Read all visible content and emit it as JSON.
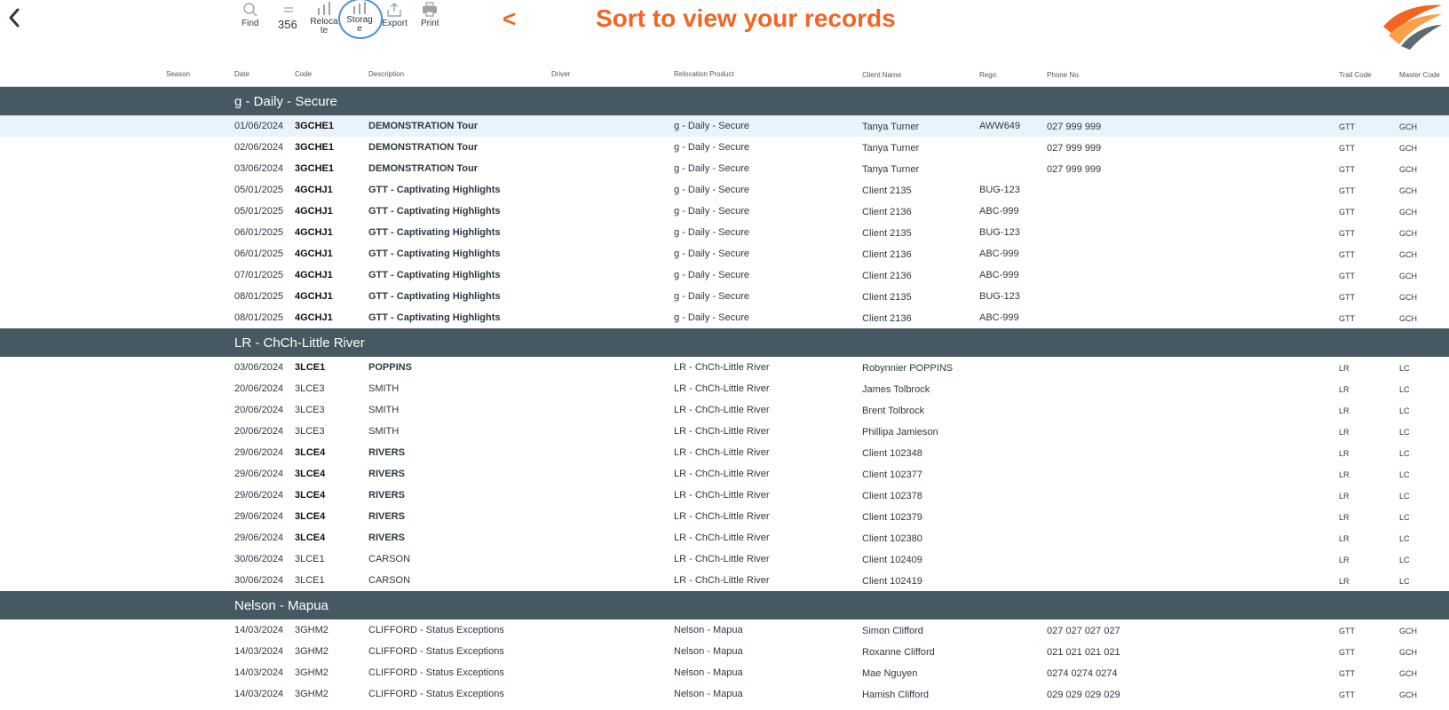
{
  "toolbar": {
    "find_label": "Find",
    "count": "356",
    "relocate_label": "Relocate",
    "storage_label": "Storage",
    "export_label": "Export",
    "print_label": "Print",
    "arrow_text": "<",
    "title": "Sort to view your records"
  },
  "columns": {
    "season": "Season",
    "date": "Date",
    "code": "Code",
    "description": "Description",
    "driver": "Driver",
    "product": "Relocation Product",
    "client": "Client Name",
    "rego": "Rego",
    "phone": "Phone No.",
    "trail": "Trail Code",
    "master": "Master Code"
  },
  "colors": {
    "accent": "#f26522",
    "group_header_bg": "#465861",
    "selected_row_bg": "#eaf2fb",
    "storage_ring": "#4a90d9"
  },
  "groups": [
    {
      "title": "g - Daily - Secure",
      "rows": [
        {
          "date": "01/06/2024",
          "code": "3GCHE1",
          "desc": "DEMONSTRATION Tour",
          "product": "g - Daily - Secure",
          "client": "Tanya Turner",
          "rego": "AWW649",
          "phone": "027 999 999",
          "trail": "GTT",
          "master": "GCH",
          "bold": true,
          "selected": true
        },
        {
          "date": "02/06/2024",
          "code": "3GCHE1",
          "desc": "DEMONSTRATION Tour",
          "product": "g - Daily - Secure",
          "client": "Tanya Turner",
          "rego": "",
          "phone": "027 999 999",
          "trail": "GTT",
          "master": "GCH",
          "bold": true
        },
        {
          "date": "03/06/2024",
          "code": "3GCHE1",
          "desc": "DEMONSTRATION Tour",
          "product": "g - Daily - Secure",
          "client": "Tanya Turner",
          "rego": "",
          "phone": "027 999 999",
          "trail": "GTT",
          "master": "GCH",
          "bold": true
        },
        {
          "date": "05/01/2025",
          "code": "4GCHJ1",
          "desc": "GTT - Captivating Highlights",
          "product": "g - Daily - Secure",
          "client": "Client 2135",
          "rego": "BUG-123",
          "phone": "",
          "trail": "GTT",
          "master": "GCH",
          "bold": true
        },
        {
          "date": "05/01/2025",
          "code": "4GCHJ1",
          "desc": "GTT - Captivating Highlights",
          "product": "g - Daily - Secure",
          "client": "Client 2136",
          "rego": "ABC-999",
          "phone": "",
          "trail": "GTT",
          "master": "GCH",
          "bold": true
        },
        {
          "date": "06/01/2025",
          "code": "4GCHJ1",
          "desc": "GTT - Captivating Highlights",
          "product": "g - Daily - Secure",
          "client": "Client 2135",
          "rego": "BUG-123",
          "phone": "",
          "trail": "GTT",
          "master": "GCH",
          "bold": true
        },
        {
          "date": "06/01/2025",
          "code": "4GCHJ1",
          "desc": "GTT - Captivating Highlights",
          "product": "g - Daily - Secure",
          "client": "Client 2136",
          "rego": "ABC-999",
          "phone": "",
          "trail": "GTT",
          "master": "GCH",
          "bold": true
        },
        {
          "date": "07/01/2025",
          "code": "4GCHJ1",
          "desc": "GTT - Captivating Highlights",
          "product": "g - Daily - Secure",
          "client": "Client 2136",
          "rego": "ABC-999",
          "phone": "",
          "trail": "GTT",
          "master": "GCH",
          "bold": true
        },
        {
          "date": "08/01/2025",
          "code": "4GCHJ1",
          "desc": "GTT - Captivating Highlights",
          "product": "g - Daily - Secure",
          "client": "Client 2135",
          "rego": "BUG-123",
          "phone": "",
          "trail": "GTT",
          "master": "GCH",
          "bold": true
        },
        {
          "date": "08/01/2025",
          "code": "4GCHJ1",
          "desc": "GTT - Captivating Highlights",
          "product": "g - Daily - Secure",
          "client": "Client 2136",
          "rego": "ABC-999",
          "phone": "",
          "trail": "GTT",
          "master": "GCH",
          "bold": true
        }
      ]
    },
    {
      "title": "LR - ChCh-Little River",
      "rows": [
        {
          "date": "03/06/2024",
          "code": "3LCE1",
          "desc": "POPPINS",
          "product": "LR - ChCh-Little River",
          "client": "Robynnier POPPINS",
          "rego": "",
          "phone": "",
          "trail": "LR",
          "master": "LC",
          "bold": true
        },
        {
          "date": "20/06/2024",
          "code": "3LCE3",
          "desc": "SMITH",
          "product": "LR - ChCh-Little River",
          "client": "James Tolbrock",
          "rego": "",
          "phone": "",
          "trail": "LR",
          "master": "LC",
          "bold": false
        },
        {
          "date": "20/06/2024",
          "code": "3LCE3",
          "desc": "SMITH",
          "product": "LR - ChCh-Little River",
          "client": "Brent Tolbrock",
          "rego": "",
          "phone": "",
          "trail": "LR",
          "master": "LC",
          "bold": false
        },
        {
          "date": "20/06/2024",
          "code": "3LCE3",
          "desc": "SMITH",
          "product": "LR - ChCh-Little River",
          "client": "Phillipa Jamieson",
          "rego": "",
          "phone": "",
          "trail": "LR",
          "master": "LC",
          "bold": false
        },
        {
          "date": "29/06/2024",
          "code": "3LCE4",
          "desc": "RIVERS",
          "product": "LR - ChCh-Little River",
          "client": "Client 102348",
          "rego": "",
          "phone": "",
          "trail": "LR",
          "master": "LC",
          "bold": true
        },
        {
          "date": "29/06/2024",
          "code": "3LCE4",
          "desc": "RIVERS",
          "product": "LR - ChCh-Little River",
          "client": "Client 102377",
          "rego": "",
          "phone": "",
          "trail": "LR",
          "master": "LC",
          "bold": true
        },
        {
          "date": "29/06/2024",
          "code": "3LCE4",
          "desc": "RIVERS",
          "product": "LR - ChCh-Little River",
          "client": "Client 102378",
          "rego": "",
          "phone": "",
          "trail": "LR",
          "master": "LC",
          "bold": true
        },
        {
          "date": "29/06/2024",
          "code": "3LCE4",
          "desc": "RIVERS",
          "product": "LR - ChCh-Little River",
          "client": "Client 102379",
          "rego": "",
          "phone": "",
          "trail": "LR",
          "master": "LC",
          "bold": true
        },
        {
          "date": "29/06/2024",
          "code": "3LCE4",
          "desc": "RIVERS",
          "product": "LR - ChCh-Little River",
          "client": "Client 102380",
          "rego": "",
          "phone": "",
          "trail": "LR",
          "master": "LC",
          "bold": true
        },
        {
          "date": "30/06/2024",
          "code": "3LCE1",
          "desc": "CARSON",
          "product": "LR - ChCh-Little River",
          "client": "Client 102409",
          "rego": "",
          "phone": "",
          "trail": "LR",
          "master": "LC",
          "bold": false
        },
        {
          "date": "30/06/2024",
          "code": "3LCE1",
          "desc": "CARSON",
          "product": "LR - ChCh-Little River",
          "client": "Client 102419",
          "rego": "",
          "phone": "",
          "trail": "LR",
          "master": "LC",
          "bold": false
        }
      ]
    },
    {
      "title": "Nelson - Mapua",
      "rows": [
        {
          "date": "14/03/2024",
          "code": "3GHM2",
          "desc": "CLIFFORD - Status Exceptions",
          "product": "Nelson - Mapua",
          "client": "Simon Clifford",
          "rego": "",
          "phone": "027 027 027 027",
          "trail": "GTT",
          "master": "GCH",
          "bold": false
        },
        {
          "date": "14/03/2024",
          "code": "3GHM2",
          "desc": "CLIFFORD - Status Exceptions",
          "product": "Nelson - Mapua",
          "client": "Roxanne Clifford",
          "rego": "",
          "phone": "021 021 021 021",
          "trail": "GTT",
          "master": "GCH",
          "bold": false
        },
        {
          "date": "14/03/2024",
          "code": "3GHM2",
          "desc": "CLIFFORD - Status Exceptions",
          "product": "Nelson - Mapua",
          "client": "Mae Nguyen",
          "rego": "",
          "phone": "0274 0274 0274",
          "trail": "GTT",
          "master": "GCH",
          "bold": false
        },
        {
          "date": "14/03/2024",
          "code": "3GHM2",
          "desc": "CLIFFORD - Status Exceptions",
          "product": "Nelson - Mapua",
          "client": "Hamish Clifford",
          "rego": "",
          "phone": "029 029 029 029",
          "trail": "GTT",
          "master": "GCH",
          "bold": false
        }
      ]
    }
  ]
}
